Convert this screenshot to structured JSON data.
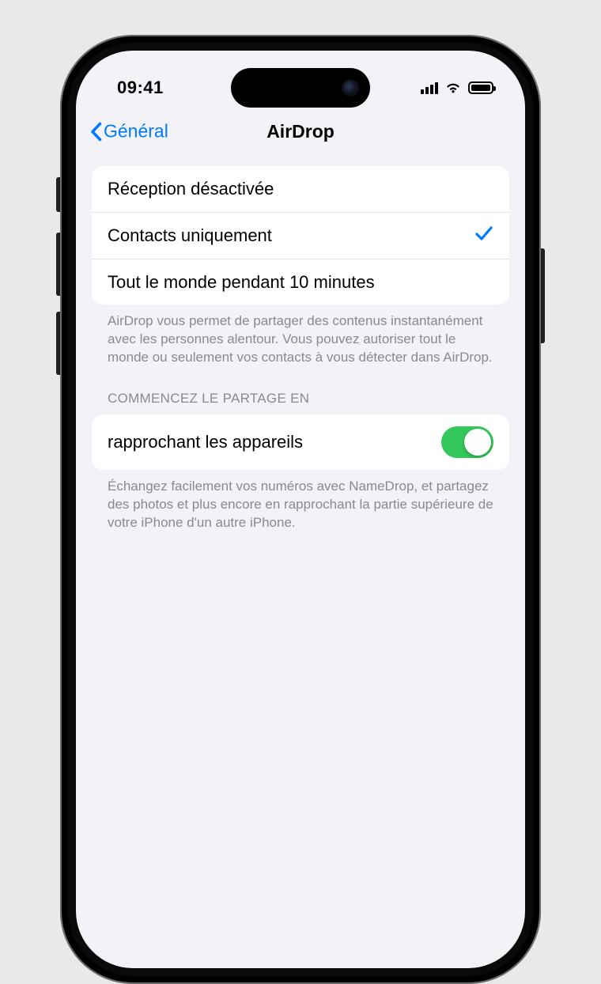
{
  "statusbar": {
    "time": "09:41"
  },
  "nav": {
    "back_label": "Général",
    "title": "AirDrop"
  },
  "receiving": {
    "options": [
      {
        "label": "Réception désactivée",
        "selected": false
      },
      {
        "label": "Contacts uniquement",
        "selected": true
      },
      {
        "label": "Tout le monde pendant 10 minutes",
        "selected": false
      }
    ],
    "footer": "AirDrop vous permet de partager des contenus instantanément avec les personnes alentour. Vous pouvez autoriser tout le monde ou seulement vos contacts à vous détecter dans AirDrop."
  },
  "sharing": {
    "header": "Commencez le partage en",
    "row_label": "rapprochant les appareils",
    "toggle_on": true,
    "footer": "Échangez facilement vos numéros avec NameDrop, et partagez des photos et plus encore en rapprochant la partie supérieure de votre iPhone d'un autre iPhone."
  },
  "colors": {
    "accent": "#007aff",
    "toggle_on": "#34c759",
    "bg": "#f2f2f7"
  }
}
